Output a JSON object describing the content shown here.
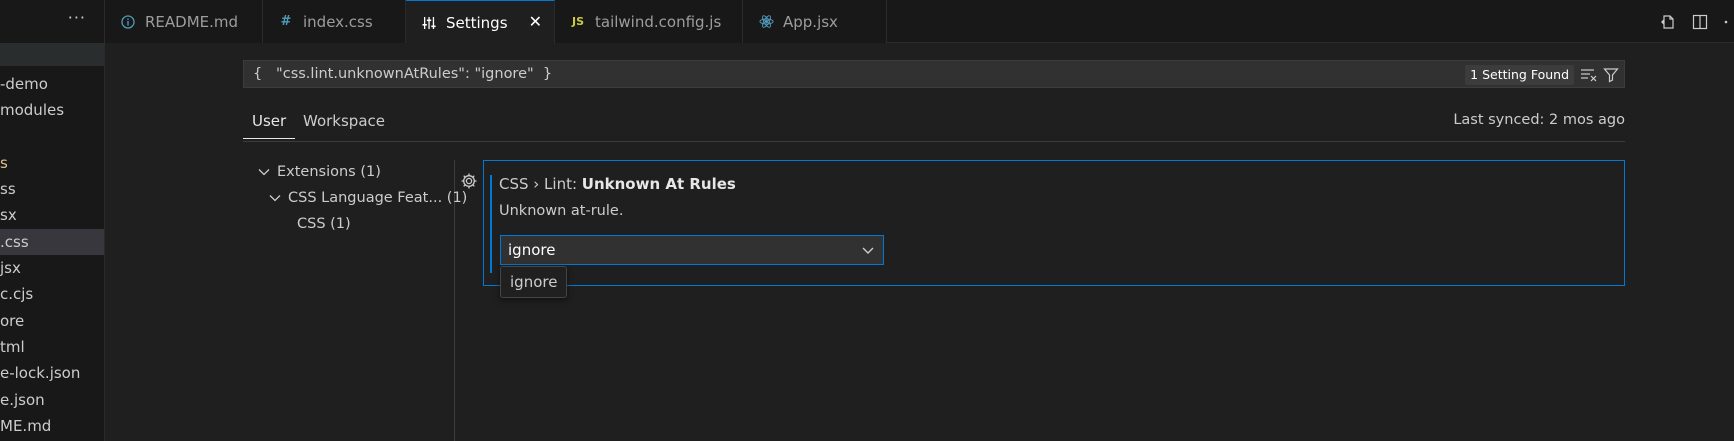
{
  "sidebar": {
    "more_label": "···",
    "files": [
      {
        "label": "-demo",
        "kind": "folder"
      },
      {
        "label": "modules",
        "kind": "folder"
      },
      {
        "label": "",
        "kind": "folder"
      },
      {
        "label": "s",
        "kind": "folder"
      },
      {
        "label": "ss",
        "kind": "file"
      },
      {
        "label": "sx",
        "kind": "file"
      },
      {
        "label": ".css",
        "kind": "file"
      },
      {
        "label": "jsx",
        "kind": "file"
      },
      {
        "label": "c.cjs",
        "kind": "file"
      },
      {
        "label": "ore",
        "kind": "file"
      },
      {
        "label": "tml",
        "kind": "file"
      },
      {
        "label": "e-lock.json",
        "kind": "file"
      },
      {
        "label": "e.json",
        "kind": "file"
      },
      {
        "label": "ME.md",
        "kind": "file"
      }
    ]
  },
  "tabs": [
    {
      "label": "README.md",
      "icon": "info-icon",
      "active": false
    },
    {
      "label": "index.css",
      "icon": "hash-icon",
      "active": false
    },
    {
      "label": "Settings",
      "icon": "settings-sliders-icon",
      "active": true
    },
    {
      "label": "tailwind.config.js",
      "icon": "js-icon",
      "active": false
    },
    {
      "label": "App.jsx",
      "icon": "react-icon",
      "active": false
    }
  ],
  "tab_icons": {
    "js": "JS",
    "hash": "#",
    "close": "✕"
  },
  "settings": {
    "search_value": "{   \"css.lint.unknownAtRules\": \"ignore\"  }",
    "found_label": "1 Setting Found",
    "scope_tabs": [
      "User",
      "Workspace"
    ],
    "last_synced": "Last synced: 2 mos ago",
    "toc": [
      {
        "label": "Extensions (1)",
        "expanded": true,
        "level": 0
      },
      {
        "label": "CSS Language Feat... (1)",
        "expanded": true,
        "level": 1
      },
      {
        "label": "CSS (1)",
        "level": 2
      }
    ],
    "setting": {
      "category": "CSS › Lint: ",
      "name": "Unknown At Rules",
      "description": "Unknown at-rule.",
      "value": "ignore",
      "hover_option": "ignore"
    }
  },
  "colors": {
    "accent": "#0078d4",
    "background": "#1f1f1f",
    "sidebar": "#181818",
    "js_yellow": "#cbcb41",
    "css_blue": "#519aba",
    "react_blue": "#519aba"
  }
}
